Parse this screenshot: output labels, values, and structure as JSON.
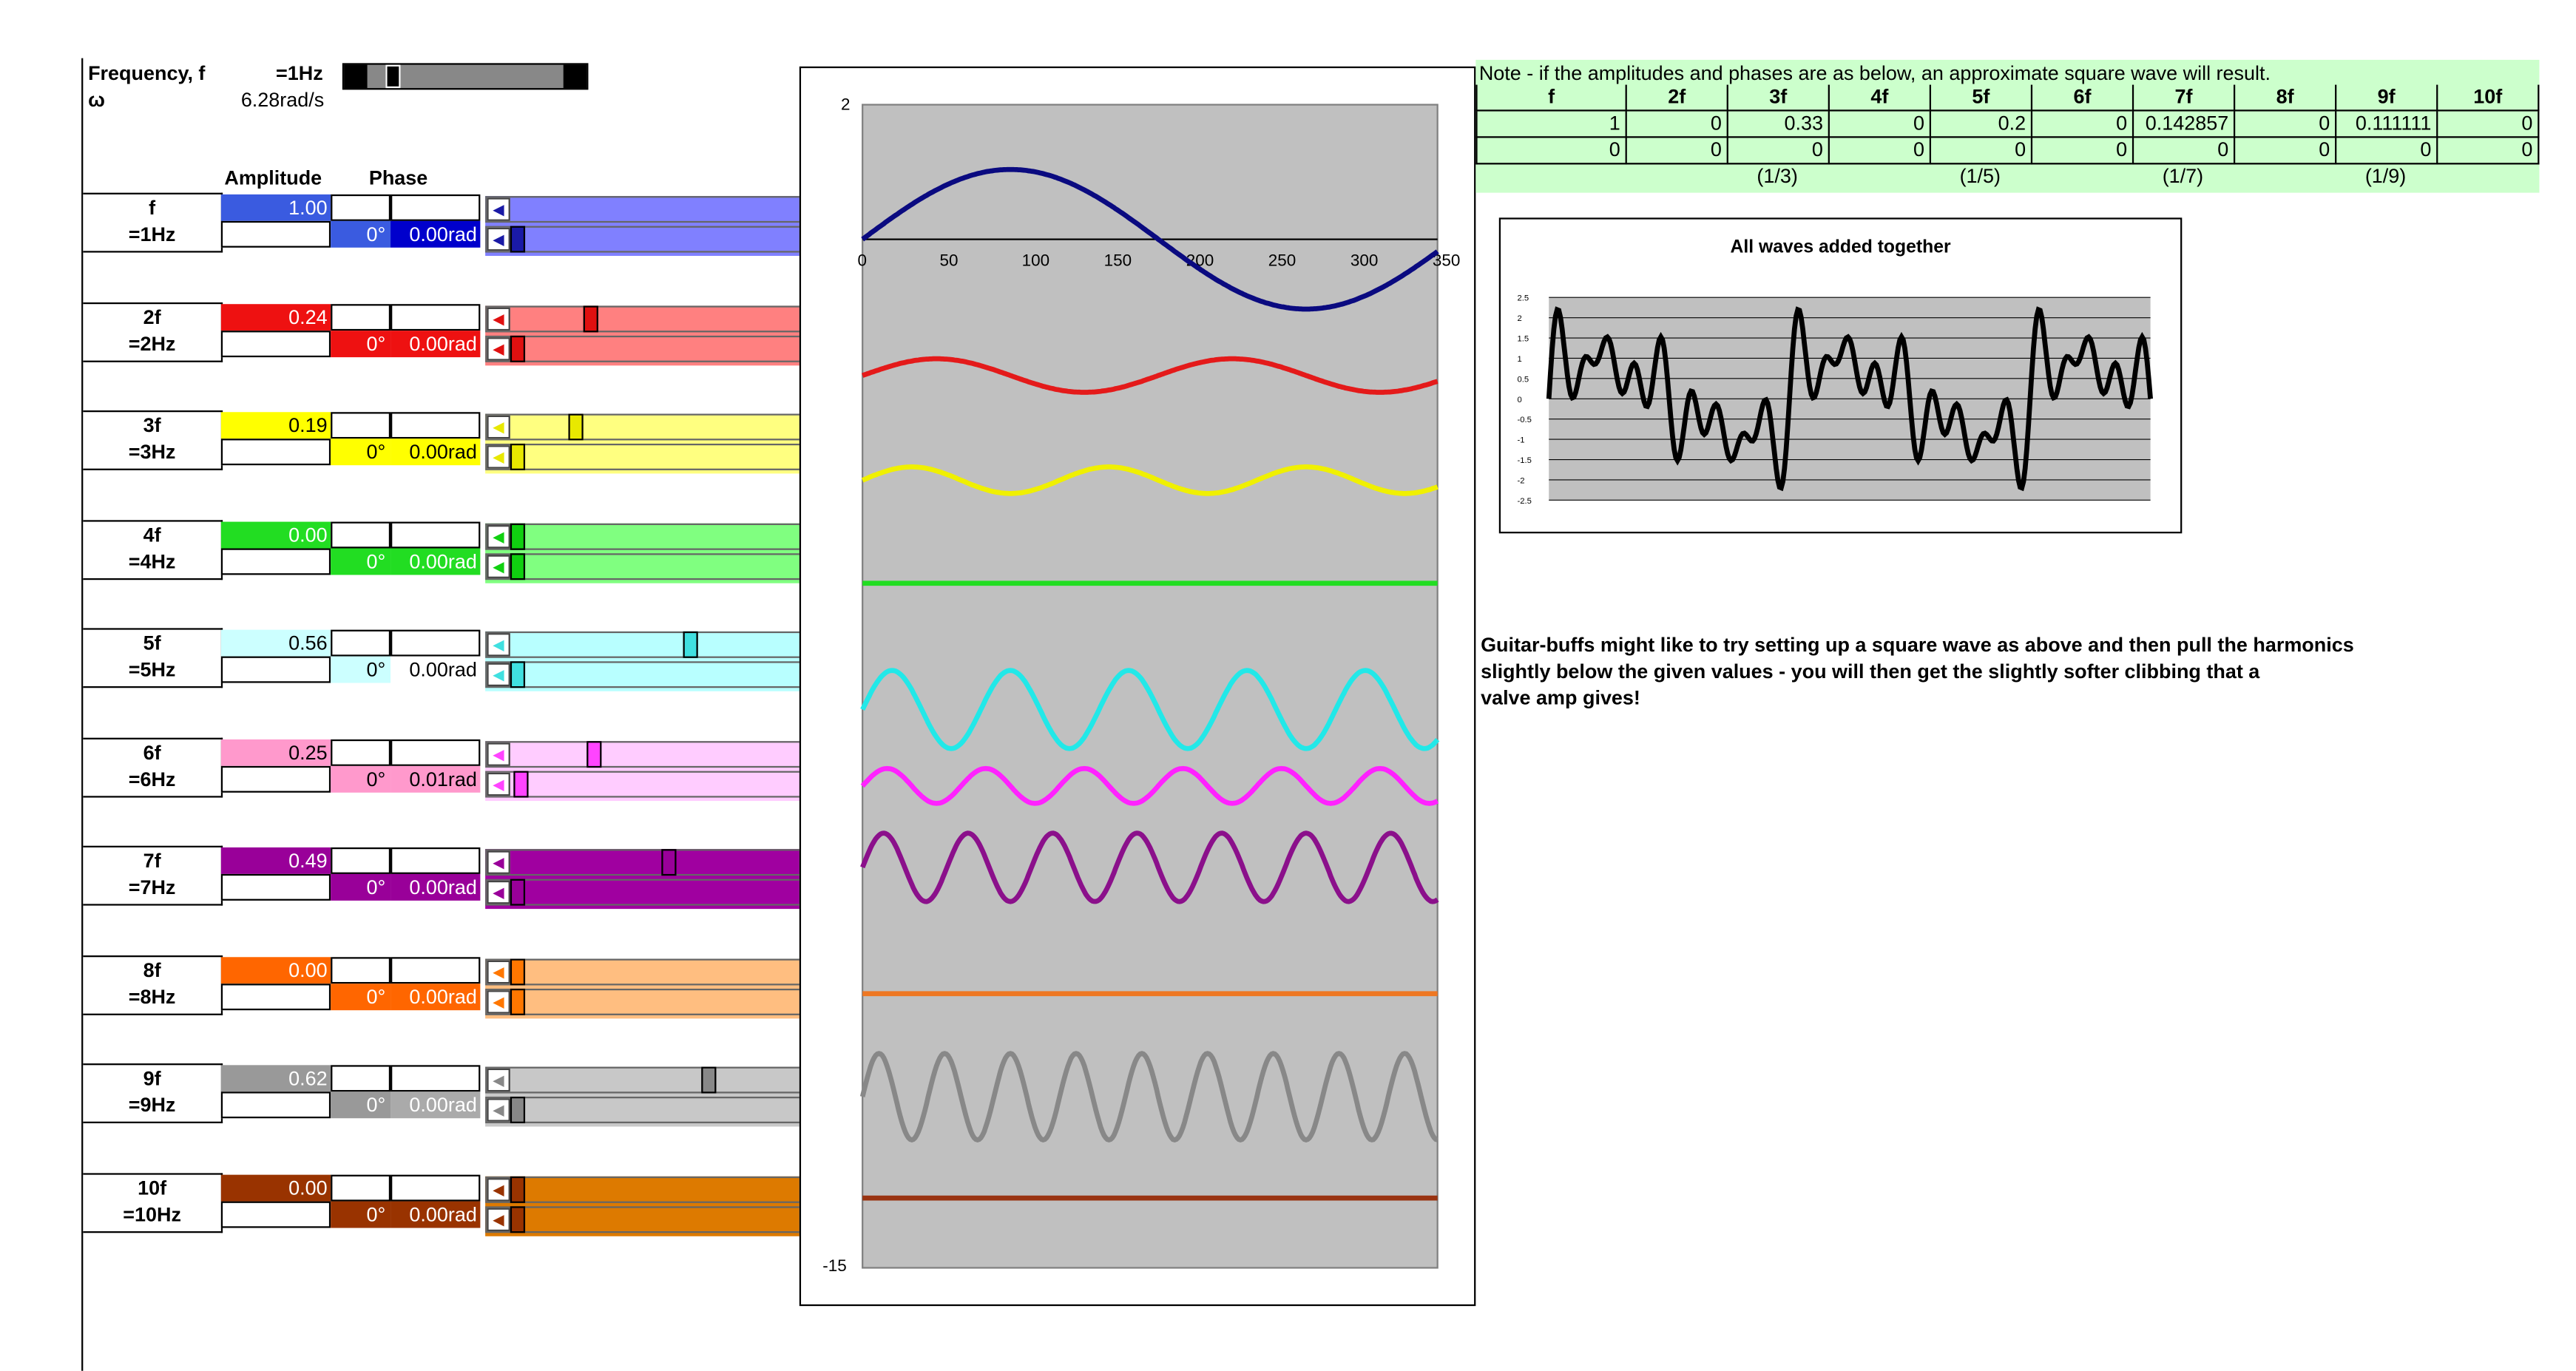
{
  "header": {
    "freq_label": "Frequency, f",
    "freq_value": "=1Hz",
    "omega_label": "ω",
    "omega_value": "6.28rad/s",
    "amplitude_col": "Amplitude",
    "phase_col": "Phase",
    "freq_slider_level": 0.1
  },
  "harmonics": [
    {
      "name": "f",
      "hz": "=1Hz",
      "amp": "1.00",
      "deg": "0°",
      "rad": "0.00rad",
      "color": "#1a1aa6",
      "cellcolor": "#3a5be0",
      "band": "#8080ff",
      "wave": "#0a0a80",
      "amp_level": 1.0,
      "phase_level": 0.0,
      "rad_cell": "#0000cc"
    },
    {
      "name": "2f",
      "hz": "=2Hz",
      "amp": "0.24",
      "deg": "0°",
      "rad": "0.00rad",
      "color": "#e01010",
      "cellcolor": "#ee1111",
      "band": "#ff8080",
      "wave": "#e41a1a",
      "amp_level": 0.24,
      "phase_level": 0.0,
      "rad_cell": "#ee1111"
    },
    {
      "name": "3f",
      "hz": "=3Hz",
      "amp": "0.19",
      "deg": "0°",
      "rad": "0.00rad",
      "color": "#e8e800",
      "cellcolor": "#ffff00",
      "band": "#ffff80",
      "wave": "#f0f000",
      "amp_level": 0.19,
      "phase_level": 0.0,
      "rad_cell": "#ffff00"
    },
    {
      "name": "4f",
      "hz": "=4Hz",
      "amp": "0.00",
      "deg": "0°",
      "rad": "0.00rad",
      "color": "#10d010",
      "cellcolor": "#22dd22",
      "band": "#80ff80",
      "wave": "#22dd22",
      "amp_level": 0.0,
      "phase_level": 0.0,
      "rad_cell": "#22dd22"
    },
    {
      "name": "5f",
      "hz": "=5Hz",
      "amp": "0.56",
      "deg": "0°",
      "rad": "0.00rad",
      "color": "#40e0e0",
      "cellcolor": "#ccffff",
      "band": "#b8ffff",
      "wave": "#22e8e8",
      "amp_level": 0.56,
      "phase_level": 0.0,
      "rad_cell": "#ffffff"
    },
    {
      "name": "6f",
      "hz": "=6Hz",
      "amp": "0.25",
      "deg": "0°",
      "rad": "0.01rad",
      "color": "#ff44ff",
      "cellcolor": "#ff99cc",
      "band": "#ffccff",
      "wave": "#ff22ff",
      "amp_level": 0.25,
      "phase_level": 0.01,
      "rad_cell": "#ff99cc"
    },
    {
      "name": "7f",
      "hz": "=7Hz",
      "amp": "0.49",
      "deg": "0°",
      "rad": "0.00rad",
      "color": "#990099",
      "cellcolor": "#990099",
      "band": "#a000a0",
      "wave": "#8b108b",
      "amp_level": 0.49,
      "phase_level": 0.0,
      "rad_cell": "#990099"
    },
    {
      "name": "8f",
      "hz": "=8Hz",
      "amp": "0.00",
      "deg": "0°",
      "rad": "0.00rad",
      "color": "#ff7700",
      "cellcolor": "#ff6600",
      "band": "#ffbe80",
      "wave": "#ee7722",
      "amp_level": 0.0,
      "phase_level": 0.0,
      "rad_cell": "#ff6600"
    },
    {
      "name": "9f",
      "hz": "=9Hz",
      "amp": "0.62",
      "deg": "0°",
      "rad": "0.00rad",
      "color": "#888888",
      "cellcolor": "#999999",
      "band": "#c8c8c8",
      "wave": "#888888",
      "amp_level": 0.62,
      "phase_level": 0.0,
      "rad_cell": "#aaaaaa"
    },
    {
      "name": "10f",
      "hz": "=10Hz",
      "amp": "0.00",
      "deg": "0°",
      "rad": "0.00rad",
      "color": "#993300",
      "cellcolor": "#993300",
      "band": "#dd7a00",
      "wave": "#993311",
      "amp_level": 0.0,
      "phase_level": 0.0,
      "rad_cell": "#993300"
    }
  ],
  "main_chart": {
    "y_top": "2",
    "y_bottom": "-15",
    "x_ticks": [
      "0",
      "50",
      "100",
      "150",
      "200",
      "250",
      "300",
      "350"
    ]
  },
  "note": {
    "title": "Note - if the amplitudes and phases are as below, an approximate square wave will result.",
    "headers": [
      "f",
      "2f",
      "3f",
      "4f",
      "5f",
      "6f",
      "7f",
      "8f",
      "9f",
      "10f"
    ],
    "row1": [
      "1",
      "0",
      "0.33",
      "0",
      "0.2",
      "0",
      "0.142857",
      "0",
      "0.111111",
      "0"
    ],
    "row2": [
      "0",
      "0",
      "0",
      "0",
      "0",
      "0",
      "0",
      "0",
      "0",
      "0"
    ],
    "fractions": [
      "",
      "",
      "(1/3)",
      "",
      "(1/5)",
      "",
      "(1/7)",
      "",
      "(1/9)",
      ""
    ]
  },
  "sum_chart": {
    "title": "All waves added together",
    "y_ticks": [
      "2.5",
      "2",
      "1.5",
      "1",
      "0.5",
      "0",
      "-0.5",
      "-1",
      "-1.5",
      "-2",
      "-2.5"
    ]
  },
  "guitar_note": [
    "Guitar-buffs might like to try setting up a square wave as above and then pull the harmonics",
    "slightly below the given values - you will then get the slightly softer clibbing that a",
    "valve amp gives!"
  ]
}
